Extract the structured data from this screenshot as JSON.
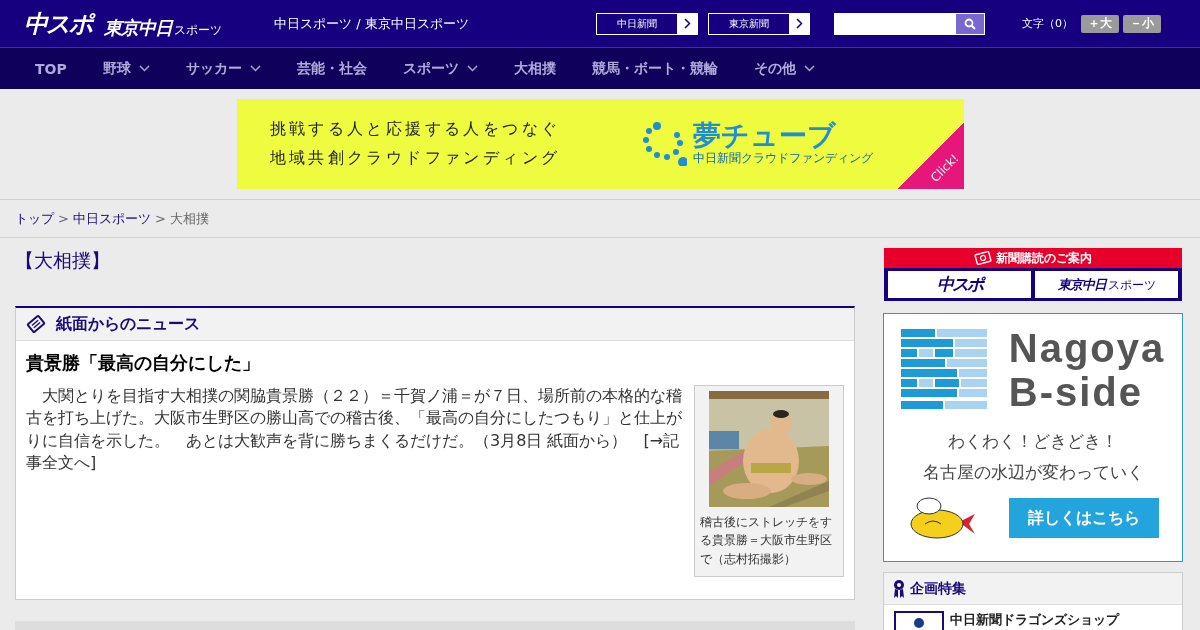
{
  "header": {
    "logo": "中スポ",
    "logo2": "東京中日",
    "logo2_sub": "スポーツ",
    "site_title": "中日スポーツ / 東京中日スポーツ",
    "links": [
      {
        "label": "中日新聞"
      },
      {
        "label": "東京新聞"
      }
    ],
    "font_label": "文字（0）",
    "font_buttons": [
      "＋大",
      "－小"
    ]
  },
  "nav": [
    {
      "label": "TOP",
      "dropdown": false
    },
    {
      "label": "野球",
      "dropdown": true
    },
    {
      "label": "サッカー",
      "dropdown": true
    },
    {
      "label": "芸能・社会",
      "dropdown": false
    },
    {
      "label": "スポーツ",
      "dropdown": true
    },
    {
      "label": "大相撲",
      "dropdown": false
    },
    {
      "label": "競馬・ボート・競輪",
      "dropdown": false
    },
    {
      "label": "その他",
      "dropdown": true
    }
  ],
  "banner": {
    "lines": [
      "挑戦する人と応援する人をつなぐ",
      "地域共創クラウドファンディング"
    ],
    "brand": "夢チューブ",
    "brand_sub": "中日新聞クラウドファンディング",
    "corner": "Click!"
  },
  "breadcrumb": [
    {
      "label": "トップ",
      "link": true
    },
    {
      "label": "中日スポーツ",
      "link": true,
      "separator": ">"
    },
    {
      "label": "大相撲",
      "link": false,
      "separator": ">"
    }
  ],
  "category": "【大相撲】",
  "news": {
    "section_title": "紙面からのニュース",
    "headline": "貴景勝「最高の自分にした」",
    "body": "　大関とりを目指す大相撲の関脇貴景勝（２２）＝千賀ノ浦＝が７日、場所前の本格的な稽古を打ち上げた。大阪市生野区の勝山高での稽古後、「最高の自分にしたつもり」と仕上がりに自信を示した。　あとは大歓声を背に勝ちまくるだけだ。（3月8日 紙面から）　[→記事全文へ]",
    "caption": "稽古後にストレッチをする貴景勝＝大阪市生野区で（志村拓撮影）"
  },
  "sidebar": {
    "subscribe": {
      "title": "新聞購読のご案内",
      "logo1": "中スポ",
      "logo2": "東京中日",
      "logo2_sub": "スポーツ"
    },
    "ad": {
      "title_lines": [
        "Nagoya",
        "B-side"
      ],
      "lines": [
        "わくわく！どきどき！",
        "名古屋の水辺が変わっていく"
      ],
      "button": "詳しくはこちら"
    },
    "feature": {
      "title": "企画特集",
      "items": [
        "中日新聞ドラゴンズショップ"
      ]
    }
  }
}
